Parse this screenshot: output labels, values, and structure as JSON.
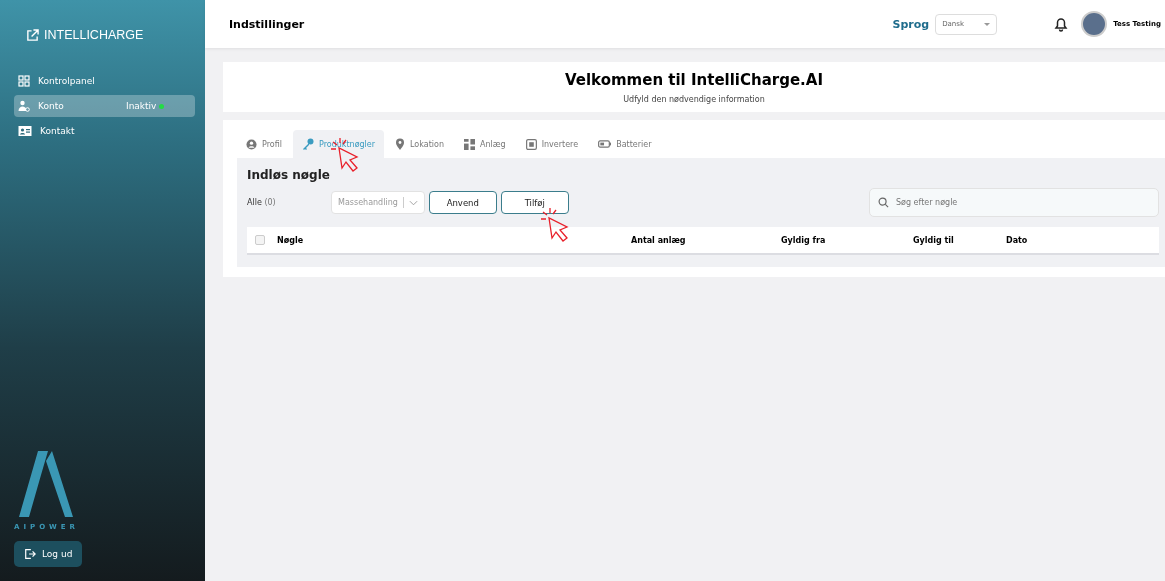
{
  "sidebar": {
    "brand": "INTELLICHARGE",
    "items": [
      {
        "label": "Kontrolpanel",
        "selected": false
      },
      {
        "label": "Konto",
        "selected": true,
        "status": "Inaktiv"
      },
      {
        "label": "Kontakt",
        "selected": false
      }
    ],
    "logo_text": "AIPOWER",
    "logout": "Log ud"
  },
  "header": {
    "title": "Indstillinger",
    "language_label": "Sprog",
    "language": "Dansk",
    "user": "Tess Testing"
  },
  "welcome": {
    "title": "Velkommen til IntelliCharge.AI",
    "subtitle": "Udfyld den nødvendige information"
  },
  "tabs": [
    {
      "label": "Profil",
      "selected": false
    },
    {
      "label": "Produktnøgler",
      "selected": true
    },
    {
      "label": "Lokation",
      "selected": false
    },
    {
      "label": "Anlæg",
      "selected": false
    },
    {
      "label": "Invertere",
      "selected": false
    },
    {
      "label": "Batterier",
      "selected": false
    }
  ],
  "panel": {
    "title": "Indløs nøgle",
    "filter_label": "Alle",
    "filter_count": "(0)",
    "bulk_action": "Massehandling",
    "buttons": [
      "Anvend",
      "Tilføj"
    ],
    "search": {
      "placeholder": "Søg efter nøgle"
    },
    "select_all_checked": false,
    "columns": [
      "Nøgle",
      "Antal anlæg",
      "Gyldig fra",
      "Gyldig til",
      "Dato"
    ]
  }
}
